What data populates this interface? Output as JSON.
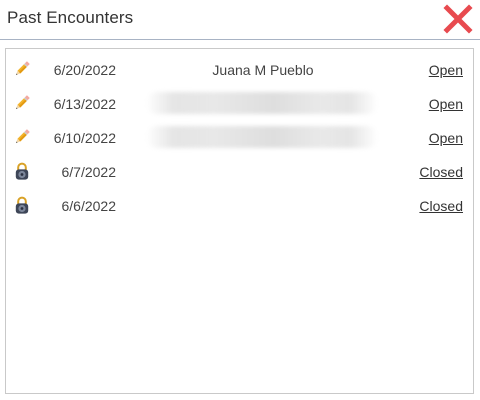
{
  "dialog": {
    "title": "Past Encounters",
    "close_icon": "close-x-icon",
    "close_color": "#e84a4f"
  },
  "encounters": [
    {
      "icon": "pencil-icon",
      "date": "6/20/2022",
      "name": "Juana M Pueblo",
      "status": "Open"
    },
    {
      "icon": "pencil-icon",
      "date": "6/13/2022",
      "name": "",
      "name_obscured": true,
      "status": "Open"
    },
    {
      "icon": "pencil-icon",
      "date": "6/10/2022",
      "name": "",
      "name_obscured": true,
      "status": "Open"
    },
    {
      "icon": "padlock-icon",
      "date": "6/7/2022",
      "name": "",
      "status": "Closed"
    },
    {
      "icon": "padlock-icon",
      "date": "6/6/2022",
      "name": "",
      "status": "Closed"
    }
  ]
}
